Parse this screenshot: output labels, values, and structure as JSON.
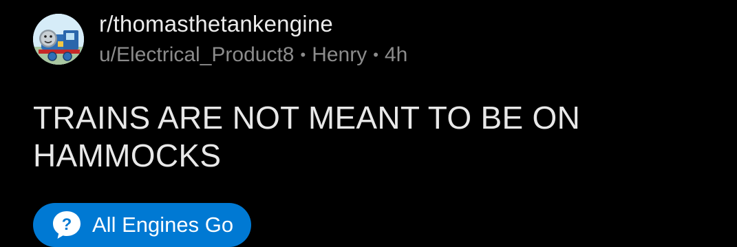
{
  "post": {
    "subreddit": "r/thomasthetankengine",
    "author": "u/Electrical_Product8",
    "author_flair": "Henry",
    "separator": "•",
    "age": "4h",
    "title": "TRAINS ARE NOT MEANT TO BE ON HAMMOCKS",
    "flair": {
      "icon": "question-bubble-icon",
      "label": "All Engines Go",
      "color": "#0079d3"
    }
  },
  "colors": {
    "background": "#000000",
    "primary_text": "#e8e8e8",
    "secondary_text": "#8c8c8c",
    "flair_blue": "#0079d3"
  },
  "avatar": {
    "icon": "thomas-tank-engine-avatar"
  }
}
